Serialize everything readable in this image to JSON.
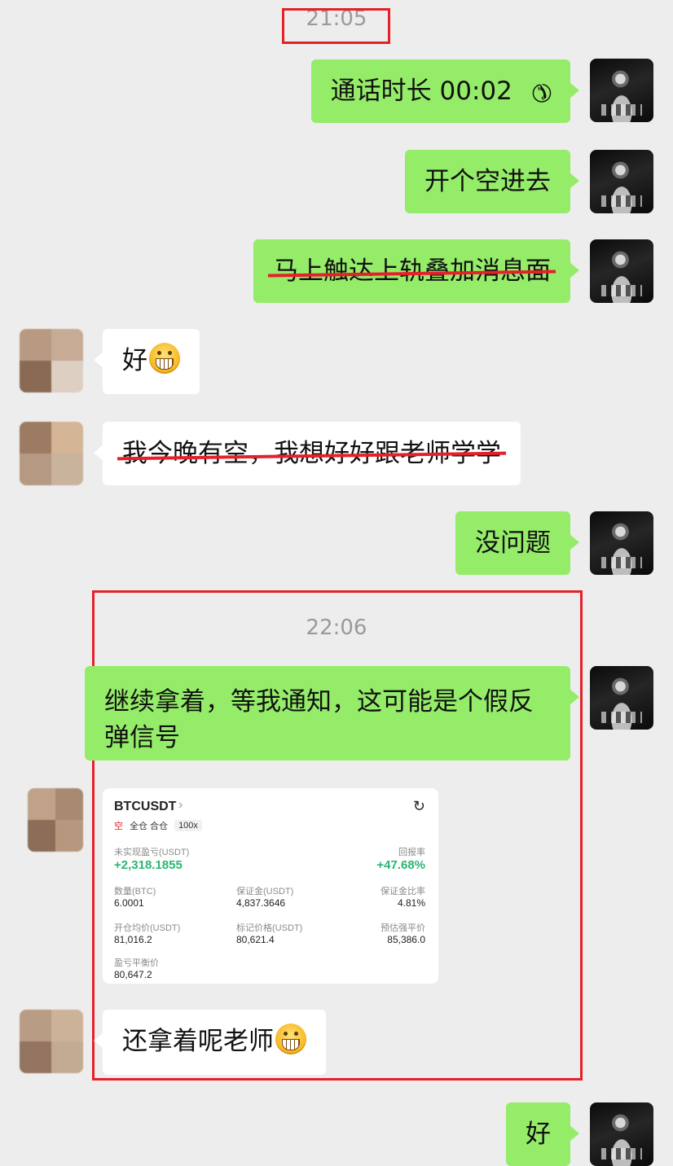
{
  "timestamps": [
    "21:05",
    "22:06"
  ],
  "messages": [
    {
      "side": "right",
      "text": "通话时长 00:02",
      "icon": "phone-hangup-icon"
    },
    {
      "side": "right",
      "text": "开个空进去"
    },
    {
      "side": "right",
      "text": "马上触达上轨叠加消息面",
      "struck": true
    },
    {
      "side": "left",
      "text": "好",
      "emoji": "grin-emoji"
    },
    {
      "side": "left",
      "text": "我今晚有空，我想好好跟老师学学",
      "struck": true
    },
    {
      "side": "right",
      "text": "没问题"
    },
    {
      "side": "right",
      "text_line1": "继续拿着，等我通知，这可能是个假反",
      "text_line2": "弹信号"
    },
    {
      "side": "left",
      "text": "还拿着呢老师",
      "emoji": "grin-emoji"
    },
    {
      "side": "right",
      "text": "好"
    }
  ],
  "trade_card": {
    "symbol": "BTCUSDT",
    "direction": "空",
    "margin_mode": "全仓 合仓",
    "leverage": "100x",
    "unrealized_pnl_label": "未实现盈亏(USDT)",
    "unrealized_pnl": "+2,318.1855",
    "roi_label": "回报率",
    "roi": "+47.68%",
    "qty_label": "数量(BTC)",
    "qty": "6.0001",
    "margin_label": "保证金(USDT)",
    "margin": "4,837.3646",
    "margin_ratio_label": "保证金比率",
    "margin_ratio": "4.81%",
    "entry_label": "开仓均价(USDT)",
    "entry": "81,016.2",
    "mark_label": "标记价格(USDT)",
    "mark": "80,621.4",
    "liq_label": "预估强平价",
    "liq": "85,386.0",
    "breakeven_label": "盈亏平衡价",
    "breakeven": "80,647.2"
  },
  "colors": {
    "background": "#ededed",
    "my_bubble": "#95ec69",
    "their_bubble": "#ffffff",
    "highlight": "#e5202a",
    "profit": "#2bb673"
  }
}
